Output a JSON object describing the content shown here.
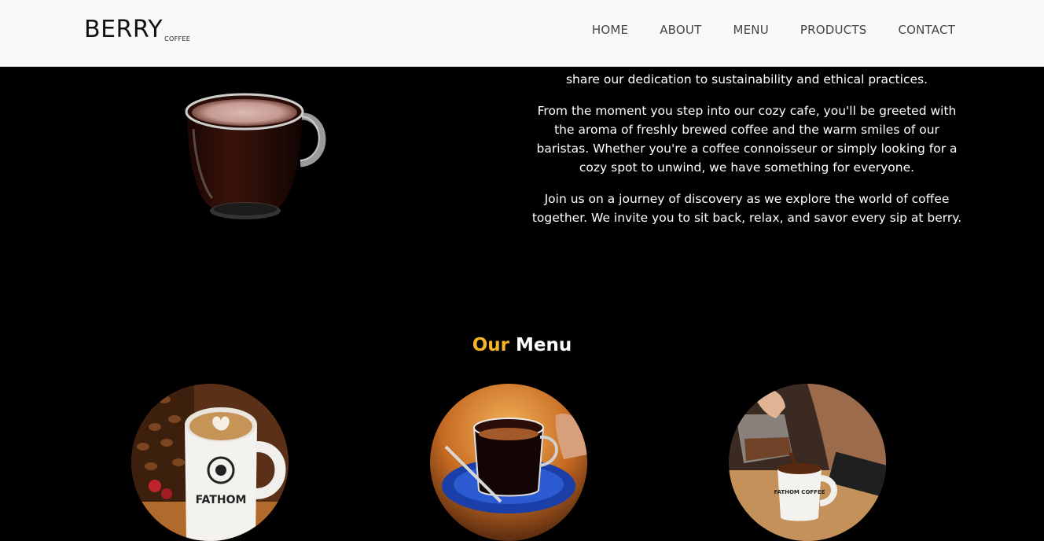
{
  "header": {
    "brand": "BERRY",
    "brand_sub": "COFFEE",
    "nav": [
      "HOME",
      "ABOUT",
      "MENU",
      "PRODUCTS",
      "CONTACT"
    ]
  },
  "about": {
    "partial_line": "share our dedication to sustainability and ethical practices.",
    "paragraph_2": "From the moment you step into our cozy cafe, you'll be greeted with the aroma of freshly brewed coffee and the warm smiles of our baristas. Whether you're a coffee connoisseur or simply looking for a cozy spot to unwind, we have something for everyone.",
    "paragraph_3": "Join us on a journey of discovery as we explore the world of coffee together. We invite you to sit back, relax, and savor every sip at berry."
  },
  "menu": {
    "title_accent": "Our",
    "title_rest": " Menu",
    "items": [
      {
        "image": "latte-mug-photo",
        "mug_text": "FATHOM"
      },
      {
        "image": "espresso-glass-photo"
      },
      {
        "image": "pour-coffee-photo",
        "mug_text": "FATHOM COFFEE"
      }
    ]
  },
  "colors": {
    "accent": "#f5b526",
    "background": "#000000",
    "header_bg": "#f8f9fb"
  }
}
